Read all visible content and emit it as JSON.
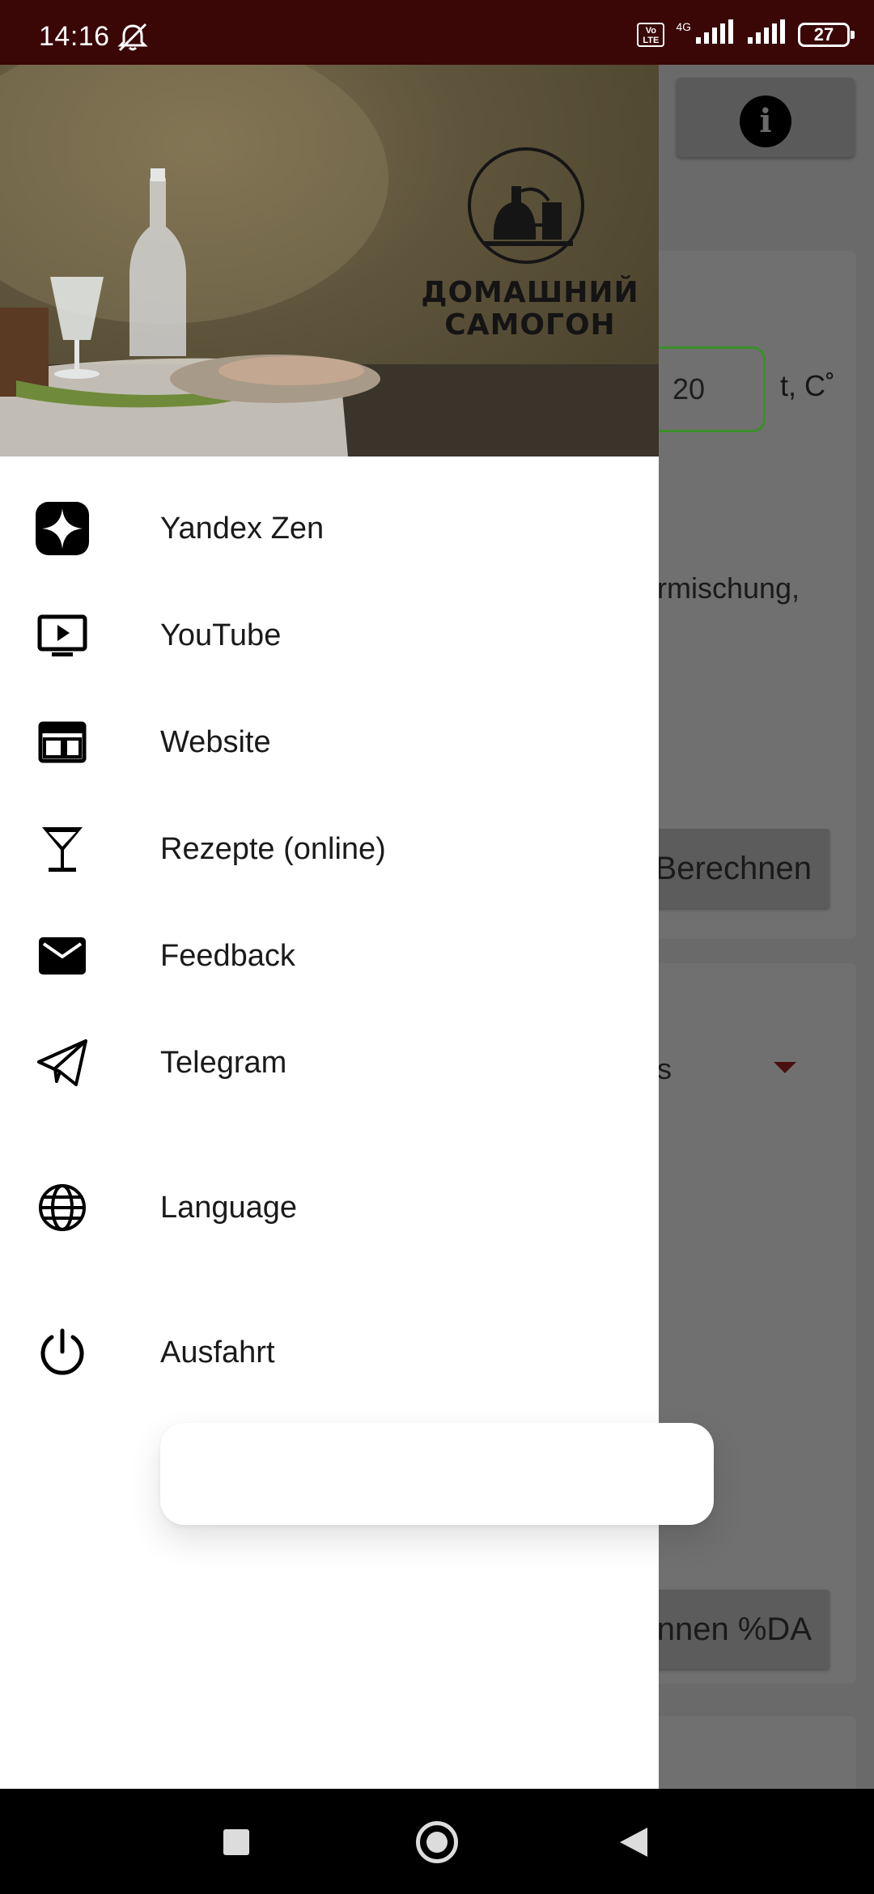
{
  "status_bar": {
    "time": "14:16",
    "volte": "Vo\nLTE",
    "network": "4G",
    "battery": "27"
  },
  "background_app": {
    "temperature_value": "20",
    "temperature_unit": "t, C˚",
    "partial_text": "rmischung,",
    "calculate_button": "Berechnen",
    "select_partial": "s",
    "calculate_da_button": "nnen %DA"
  },
  "drawer": {
    "header_logo_text": "ДОМАШНИЙ САМОГОН",
    "items": [
      {
        "label": "Yandex Zen",
        "icon": "yandex-zen-icon"
      },
      {
        "label": "YouTube",
        "icon": "youtube-icon"
      },
      {
        "label": "Website",
        "icon": "website-icon"
      },
      {
        "label": "Rezepte (online)",
        "icon": "cocktail-glass-icon"
      },
      {
        "label": "Feedback",
        "icon": "mail-icon"
      },
      {
        "label": "Telegram",
        "icon": "telegram-icon"
      },
      {
        "label": "Language",
        "icon": "globe-icon"
      },
      {
        "label": "Ausfahrt",
        "icon": "power-icon"
      }
    ]
  },
  "colors": {
    "status_bar": "#3a0606",
    "accent_green": "#3a8f2a",
    "drawer_bg": "#ffffff",
    "scrim": "#6a6a6a"
  }
}
